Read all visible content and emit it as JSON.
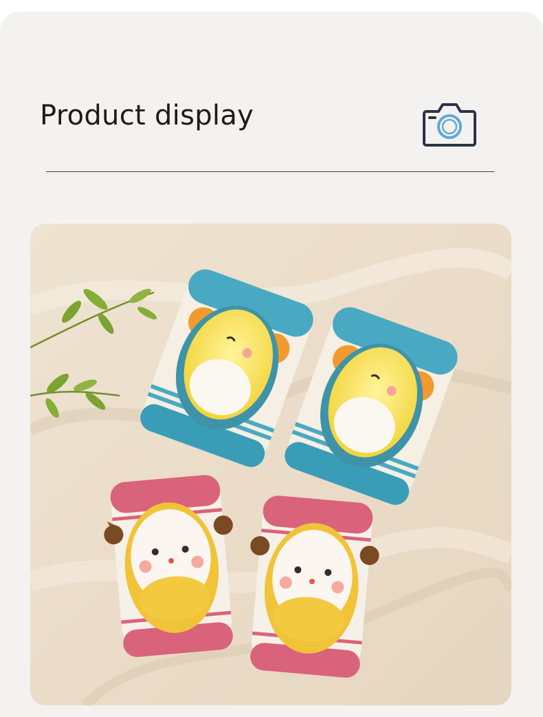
{
  "header": {
    "title": "Product display",
    "icon": "camera-icon"
  },
  "photo": {
    "subject": "product-photo"
  },
  "colors": {
    "background": "#f3f2f1",
    "text": "#1b1b1b",
    "camera_stroke": "#2a3344",
    "camera_lens": "#5fa9d8"
  }
}
